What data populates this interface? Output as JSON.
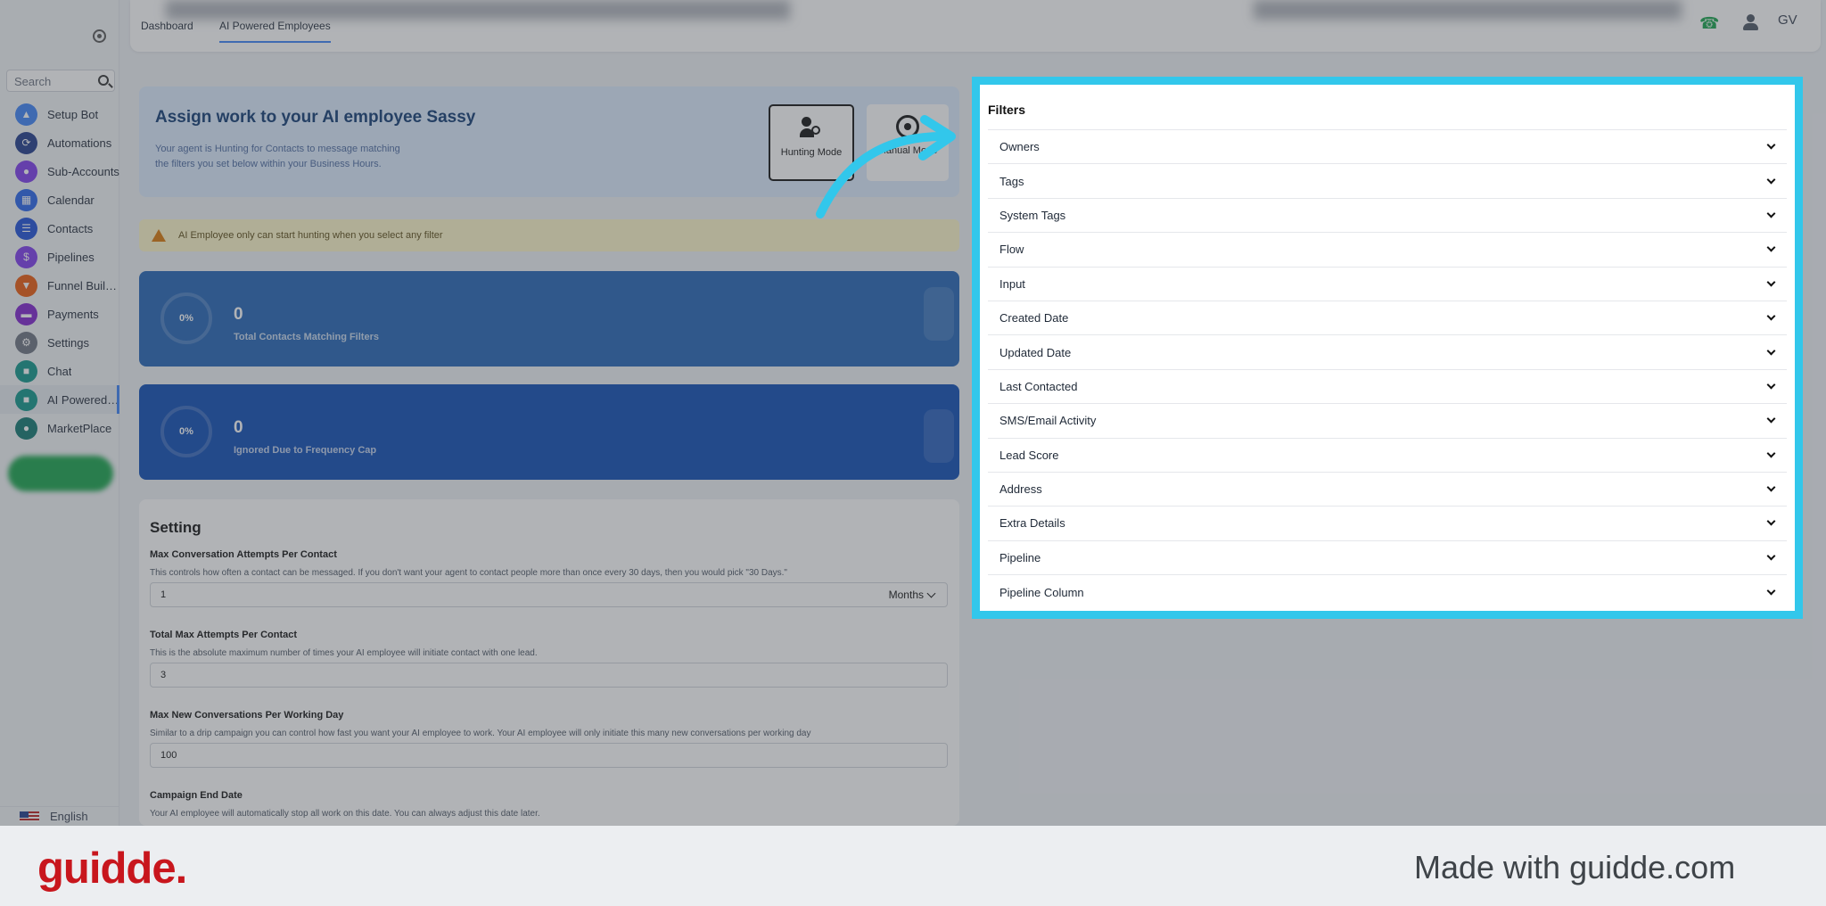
{
  "sidebar": {
    "search_placeholder": "Search",
    "items": [
      {
        "label": "Setup Bot",
        "icon": "rocket-icon",
        "color": "#3b82f6"
      },
      {
        "label": "Automations",
        "icon": "automation-icon",
        "color": "#1e3a8a"
      },
      {
        "label": "Sub-Accounts",
        "icon": "user-icon",
        "color": "#7c3aed"
      },
      {
        "label": "Calendar",
        "icon": "calendar-icon",
        "color": "#2563eb"
      },
      {
        "label": "Contacts",
        "icon": "contacts-icon",
        "color": "#1d4ed8"
      },
      {
        "label": "Pipelines",
        "icon": "dollar-icon",
        "color": "#7c3aed"
      },
      {
        "label": "Funnel Builder",
        "icon": "funnel-icon",
        "color": "#ea580c"
      },
      {
        "label": "Payments",
        "icon": "card-icon",
        "color": "#7e22ce"
      },
      {
        "label": "Settings",
        "icon": "gear-icon",
        "color": "#6b7280"
      },
      {
        "label": "Chat",
        "icon": "chat-icon",
        "color": "#0d9488"
      },
      {
        "label": "AI Powered Employees",
        "icon": "ai-chat-icon",
        "color": "#0d9488"
      },
      {
        "label": "MarketPlace",
        "icon": "marketplace-icon",
        "color": "#0f766e"
      }
    ],
    "language": "English"
  },
  "topbar": {
    "tabs": [
      "Dashboard",
      "AI Powered Employees"
    ],
    "avatar_initials": "GV"
  },
  "assign": {
    "title": "Assign work to your AI employee Sassy",
    "desc_line1": "Your agent is Hunting for Contacts to message matching",
    "desc_line2": "the filters you set below within your Business Hours.",
    "hunting_label": "Hunting Mode",
    "manual_label": "Manual Mode"
  },
  "warning": "AI Employee only can start hunting when you select any filter",
  "stats": [
    {
      "percent": "0%",
      "count": "0",
      "label": "Total Contacts Matching Filters"
    },
    {
      "percent": "0%",
      "count": "0",
      "label": "Ignored Due to Frequency Cap"
    }
  ],
  "setting": {
    "title": "Setting",
    "fields": [
      {
        "label": "Max Conversation Attempts Per Contact",
        "help": "This controls how often a contact can be messaged. If you don't want your agent to contact people more than once every 30 days, then you would pick \"30 Days.\"",
        "value": "1",
        "unit": "Months"
      },
      {
        "label": "Total Max Attempts Per Contact",
        "help": "This is the absolute maximum number of times your AI employee will initiate contact with one lead.",
        "value": "3"
      },
      {
        "label": "Max New Conversations Per Working Day",
        "help": "Similar to a drip campaign you can control how fast you want your AI employee to work. Your AI employee will only initiate this many new conversations per working day",
        "value": "100"
      },
      {
        "label": "Campaign End Date",
        "help": "Your AI employee will automatically stop all work on this date. You can always adjust this date later."
      }
    ]
  },
  "filters": {
    "title": "Filters",
    "items": [
      "Owners",
      "Tags",
      "System Tags",
      "Flow",
      "Input",
      "Created Date",
      "Updated Date",
      "Last Contacted",
      "SMS/Email Activity",
      "Lead Score",
      "Address",
      "Extra Details",
      "Pipeline",
      "Pipeline Column"
    ]
  },
  "footer": {
    "brand": "guidde.",
    "made_with": "Made with guidde.com"
  },
  "colors": {
    "highlight": "#32c7eb",
    "stat_card_1": "#2163b6",
    "stat_card_2": "#0b4ab3",
    "brand_red": "#c8161d"
  }
}
